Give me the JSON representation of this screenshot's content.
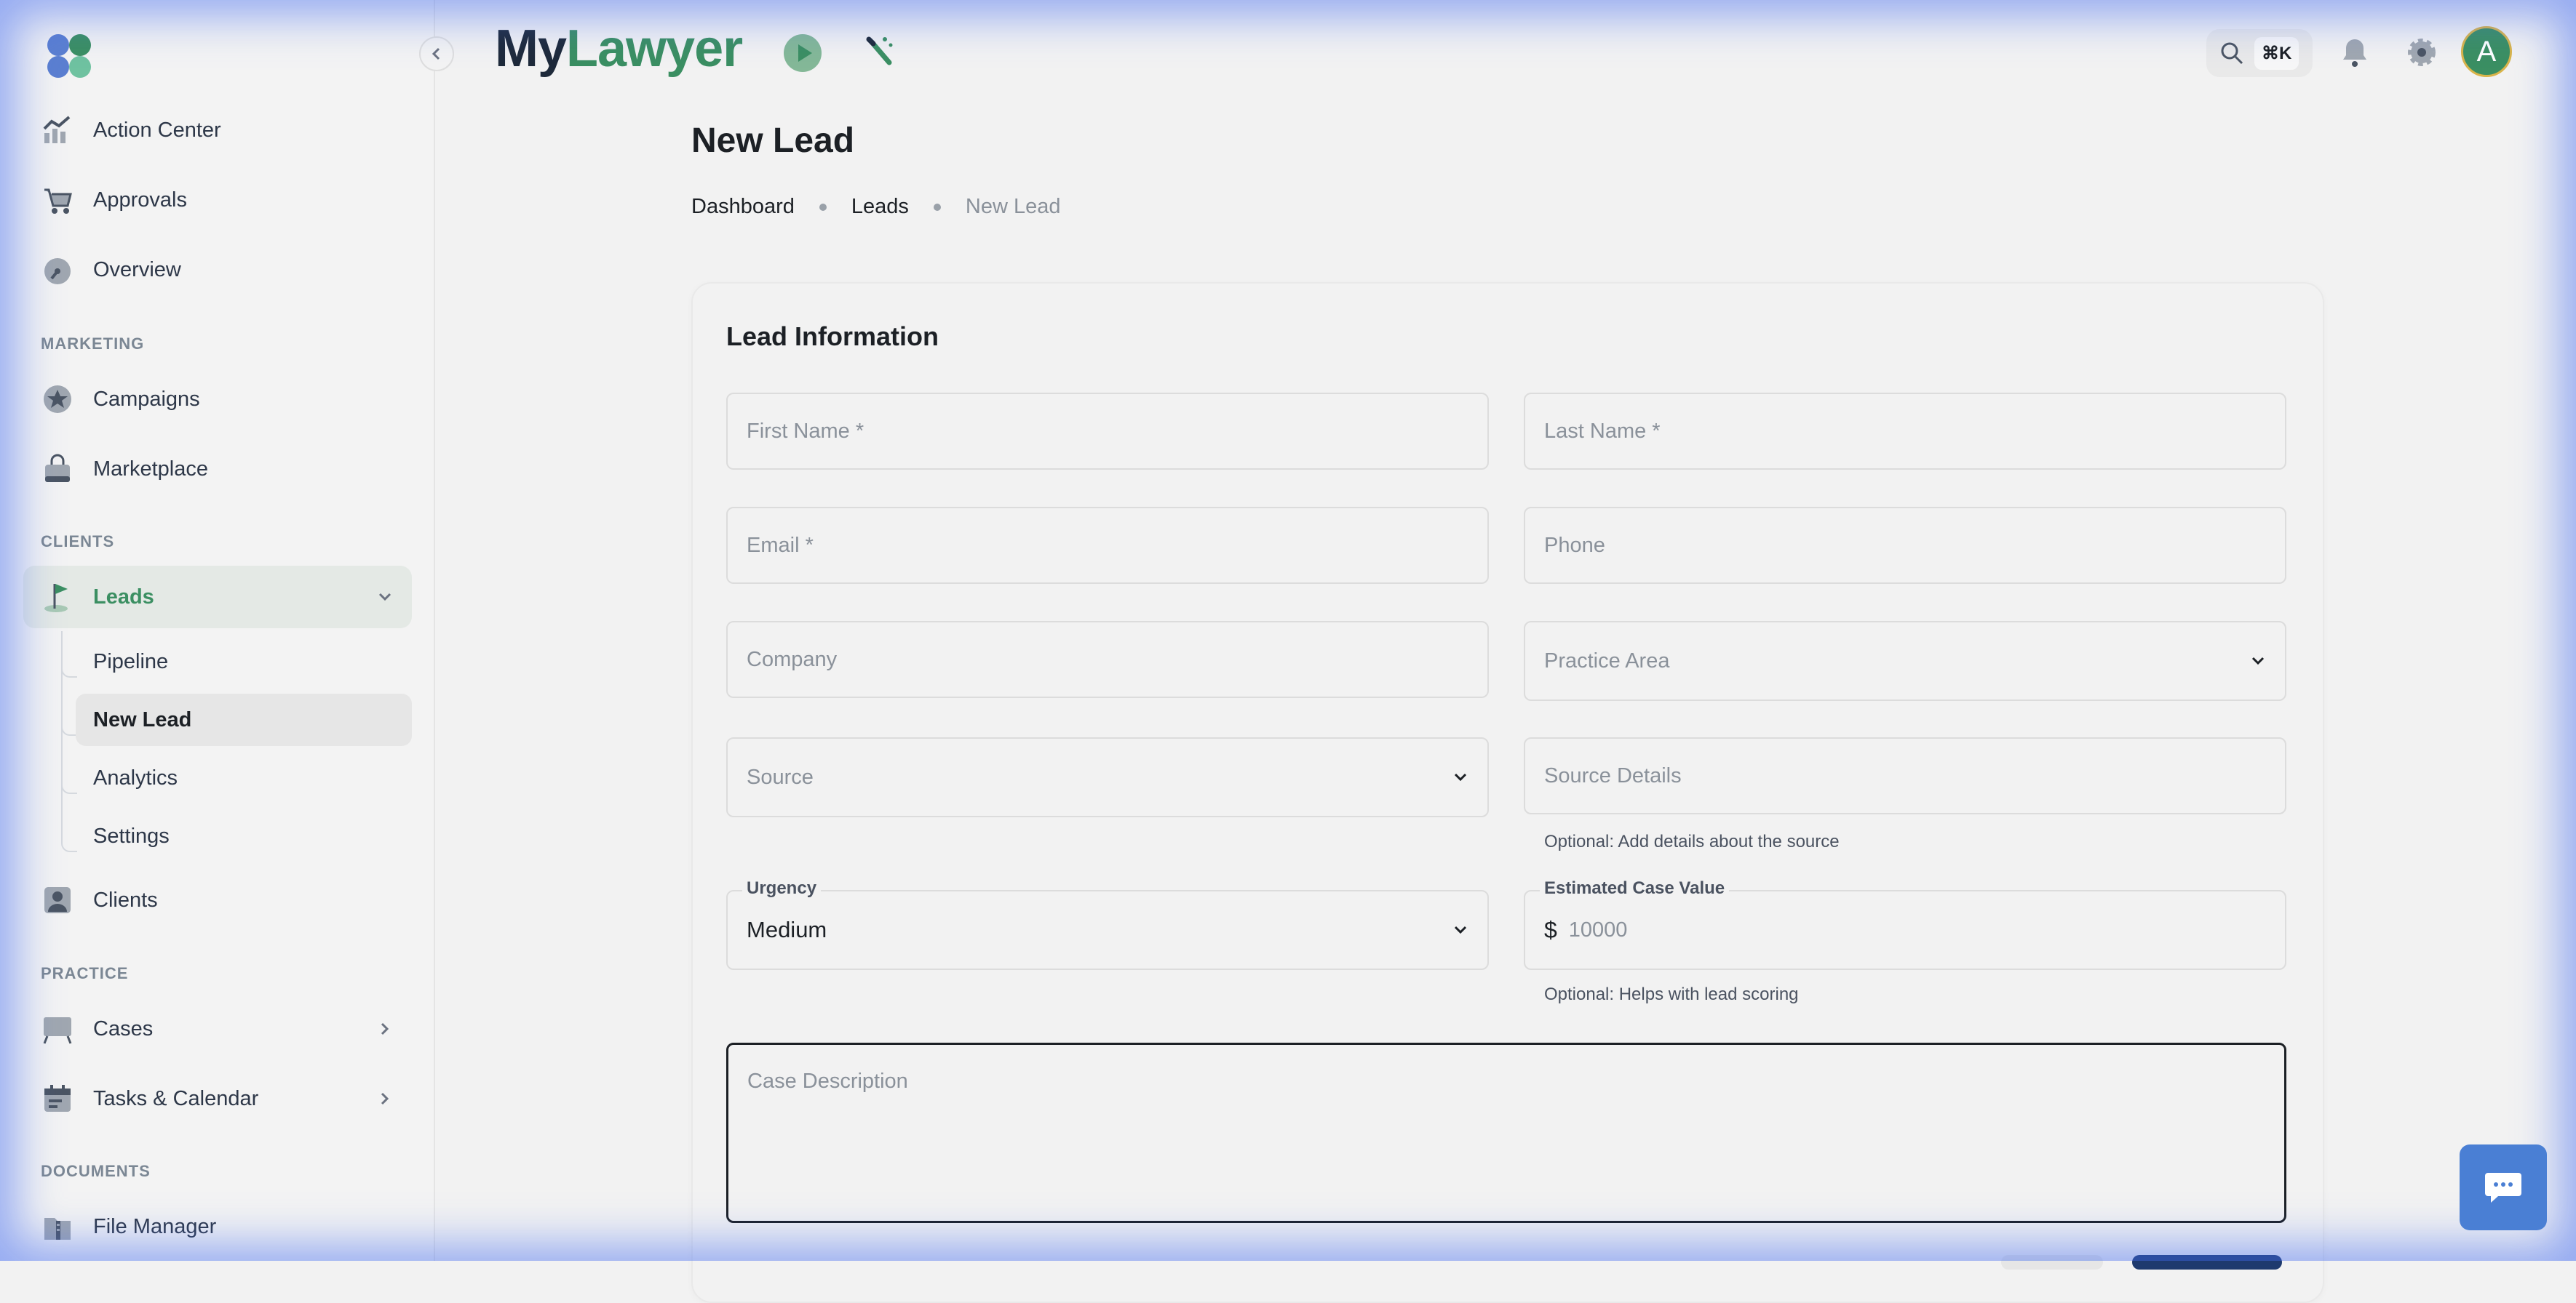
{
  "app": {
    "brand_my": "My",
    "brand_lawyer": "Lawyer"
  },
  "header": {
    "search_shortcut": "⌘K",
    "avatar_initial": "A"
  },
  "sidebar": {
    "items_top": [
      {
        "label": "Action Center",
        "icon": "chart-line-icon"
      },
      {
        "label": "Approvals",
        "icon": "cart-icon"
      },
      {
        "label": "Overview",
        "icon": "gauge-icon"
      }
    ],
    "section_marketing": "MARKETING",
    "items_marketing": [
      {
        "label": "Campaigns",
        "icon": "star-badge-icon"
      },
      {
        "label": "Marketplace",
        "icon": "shopping-bag-icon"
      }
    ],
    "section_clients": "CLIENTS",
    "leads": {
      "label": "Leads",
      "icon": "flag-icon"
    },
    "leads_sub": [
      "Pipeline",
      "New Lead",
      "Analytics",
      "Settings"
    ],
    "clients": {
      "label": "Clients",
      "icon": "person-card-icon"
    },
    "section_practice": "PRACTICE",
    "items_practice": [
      {
        "label": "Cases",
        "icon": "easel-icon"
      },
      {
        "label": "Tasks & Calendar",
        "icon": "calendar-icon"
      }
    ],
    "section_documents": "DOCUMENTS",
    "file_manager": {
      "label": "File Manager",
      "icon": "zip-folder-icon"
    }
  },
  "page": {
    "title": "New Lead",
    "breadcrumb": [
      "Dashboard",
      "Leads",
      "New Lead"
    ]
  },
  "form": {
    "card_title": "Lead Information",
    "first_name_ph": "First Name *",
    "last_name_ph": "Last Name *",
    "email_ph": "Email *",
    "phone_ph": "Phone",
    "company_ph": "Company",
    "practice_area_ph": "Practice Area",
    "source_ph": "Source",
    "source_details_ph": "Source Details",
    "source_details_help": "Optional: Add details about the source",
    "urgency_label": "Urgency",
    "urgency_value": "Medium",
    "case_value_label": "Estimated Case Value",
    "currency_symbol": "$",
    "case_value_ph": "10000",
    "case_value_help": "Optional: Helps with lead scoring",
    "description_ph": "Case Description"
  },
  "colors": {
    "accent_green": "#3b8f62",
    "brand_dark": "#1e2a3a",
    "chat_blue": "#4a7fd4"
  }
}
